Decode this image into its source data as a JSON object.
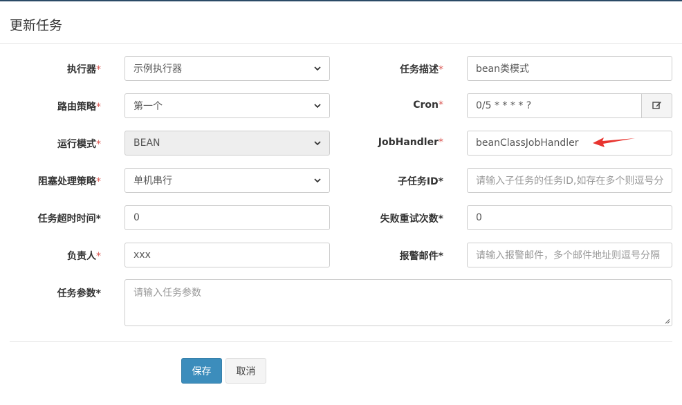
{
  "dialog": {
    "title": "更新任务"
  },
  "form": {
    "required_mark": "*",
    "executor": {
      "label": "执行器",
      "value": "示例执行器"
    },
    "job_desc": {
      "label": "任务描述",
      "value": "bean类模式"
    },
    "route_strategy": {
      "label": "路由策略",
      "value": "第一个"
    },
    "cron": {
      "label": "Cron",
      "value": "0/5 * * * * ?",
      "button_icon": "edit-icon"
    },
    "run_mode": {
      "label": "运行模式",
      "value": "BEAN"
    },
    "job_handler": {
      "label": "JobHandler",
      "value": "beanClassJobHandler"
    },
    "block_strategy": {
      "label": "阻塞处理策略",
      "value": "单机串行"
    },
    "child_job_id": {
      "label": "子任务ID*",
      "placeholder": "请输入子任务的任务ID,如存在多个则逗号分隔"
    },
    "timeout": {
      "label": "任务超时时间*",
      "value": "0"
    },
    "fail_retry": {
      "label": "失败重试次数*",
      "value": "0"
    },
    "author": {
      "label": "负责人",
      "value": "xxx"
    },
    "alarm_email": {
      "label": "报警邮件*",
      "placeholder": "请输入报警邮件，多个邮件地址则逗号分隔"
    },
    "job_param": {
      "label": "任务参数*",
      "placeholder": "请输入任务参数"
    }
  },
  "buttons": {
    "save": "保存",
    "cancel": "取消"
  },
  "annotation": {
    "arrow_color": "#e8342f"
  }
}
